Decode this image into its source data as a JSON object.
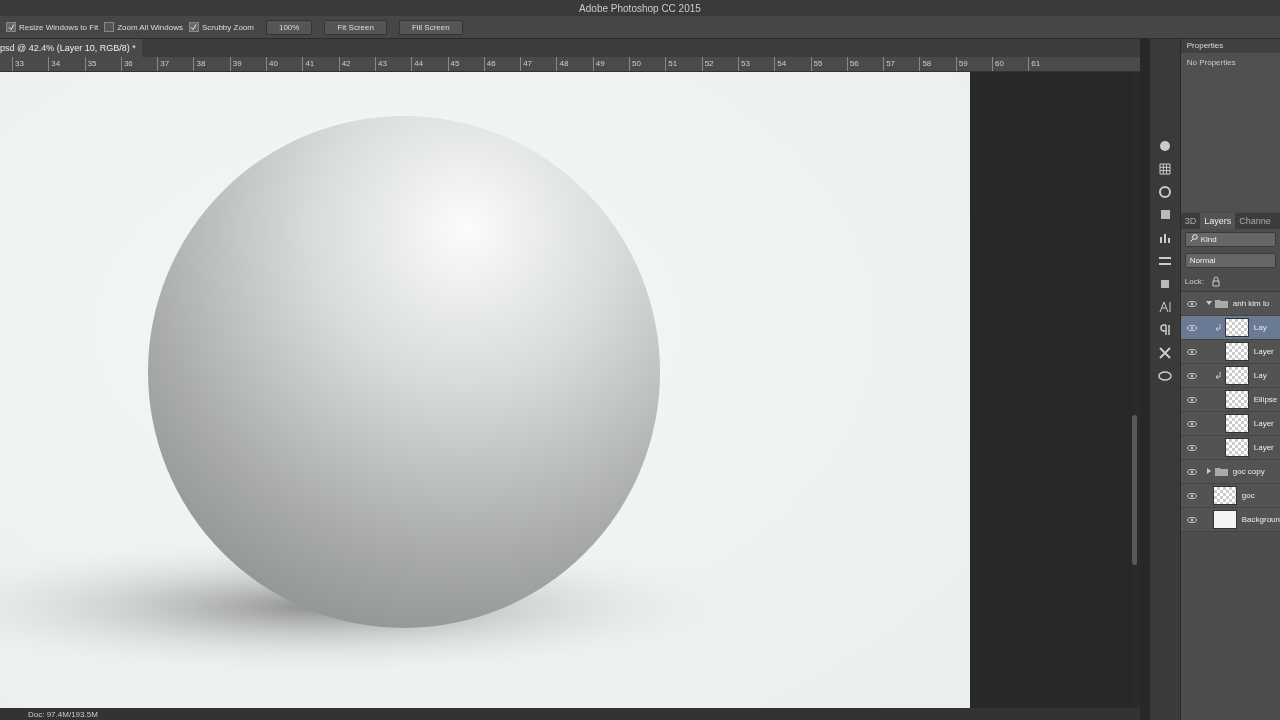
{
  "window": {
    "title": "Adobe Photoshop CC 2015"
  },
  "options_bar": {
    "checks": [
      {
        "label": "Resize Windows to Fit",
        "checked": true
      },
      {
        "label": "Zoom All Windows",
        "checked": false
      },
      {
        "label": "Scrubby Zoom",
        "checked": true
      }
    ],
    "buttons": [
      "100%",
      "Fit Screen",
      "Fill Screen"
    ]
  },
  "document_tab": {
    "title": "psd @ 42.4% (Layer 10, RGB/8) *"
  },
  "ruler": {
    "ticks": [
      "33",
      "34",
      "35",
      "36",
      "37",
      "38",
      "39",
      "40",
      "41",
      "42",
      "43",
      "44",
      "45",
      "46",
      "47",
      "48",
      "49",
      "50",
      "51",
      "52",
      "53",
      "54",
      "55",
      "56",
      "57",
      "58",
      "59",
      "60",
      "61"
    ]
  },
  "properties_panel": {
    "tab": "Properties",
    "message": "No Properties"
  },
  "layers_panel": {
    "tabs": [
      {
        "label": "3D",
        "selected": false
      },
      {
        "label": "Layers",
        "selected": true
      },
      {
        "label": "Channe",
        "selected": false
      }
    ],
    "filter": "Kind",
    "blend_mode": "Normal",
    "lock_label": "Lock:",
    "layers": [
      {
        "name": "anh kim lo",
        "kind": "group",
        "expanded": true,
        "selected": false,
        "children": [
          {
            "name": "Lay",
            "kind": "layer",
            "selected": true,
            "clipped": true
          },
          {
            "name": "Layer",
            "kind": "layer",
            "selected": false,
            "clipped": false
          },
          {
            "name": "Lay",
            "kind": "layer",
            "selected": false,
            "clipped": true
          },
          {
            "name": "Ellipse",
            "kind": "layer",
            "selected": false,
            "clipped": false
          },
          {
            "name": "Layer",
            "kind": "layer",
            "selected": false,
            "clipped": false
          },
          {
            "name": "Layer",
            "kind": "layer",
            "selected": false,
            "clipped": false
          }
        ]
      },
      {
        "name": "goc copy",
        "kind": "group",
        "expanded": false,
        "selected": false
      },
      {
        "name": "goc",
        "kind": "layer",
        "selected": false
      },
      {
        "name": "Backgroun",
        "kind": "background",
        "selected": false
      }
    ]
  },
  "status_bar": {
    "doc_size": "Doc: 97.4M/193.5M"
  }
}
